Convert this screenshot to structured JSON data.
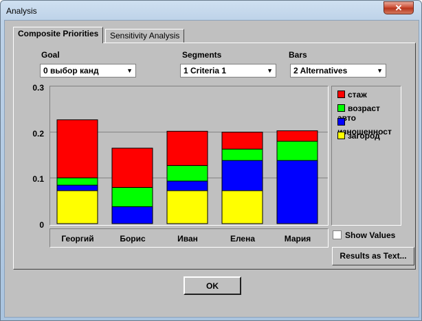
{
  "window": {
    "title": "Analysis",
    "close_label": "✕"
  },
  "tabs": [
    {
      "label": "Composite Priorities",
      "active": true
    },
    {
      "label": "Sensitivity Analysis",
      "active": false
    }
  ],
  "controls": {
    "goal": {
      "label": "Goal",
      "value": "0 выбор канд"
    },
    "segments": {
      "label": "Segments",
      "value": "1 Criteria 1"
    },
    "bars": {
      "label": "Bars",
      "value": "2 Alternatives"
    }
  },
  "chart_data": {
    "type": "bar",
    "stacked": true,
    "categories": [
      "Георгий",
      "Борис",
      "Иван",
      "Елена",
      "Мария"
    ],
    "y_ticks": [
      "0.3",
      "0.2",
      "0.1",
      "0"
    ],
    "ylim": [
      0,
      0.3
    ],
    "grid": true,
    "legend_position": "right",
    "series": [
      {
        "name": "загород",
        "color": "#ffff00",
        "values": [
          0.072,
          0,
          0.072,
          0.072,
          0
        ]
      },
      {
        "name": "изношенност",
        "color": "#0000ff",
        "values": [
          0.012,
          0.037,
          0.021,
          0.066,
          0.138
        ]
      },
      {
        "name": "возраст авто",
        "color": "#00ff00",
        "values": [
          0.016,
          0.042,
          0.034,
          0.025,
          0.042
        ]
      },
      {
        "name": "стаж",
        "color": "#ff0000",
        "values": [
          0.127,
          0.086,
          0.075,
          0.037,
          0.023
        ]
      }
    ]
  },
  "legend": [
    {
      "label": "стаж",
      "color": "#ff0000"
    },
    {
      "label": "возраст авто",
      "color": "#00ff00"
    },
    {
      "label": "изношенност",
      "color": "#0000ff"
    },
    {
      "label": "загород",
      "color": "#ffff00"
    }
  ],
  "show_values": {
    "label": "Show Values",
    "checked": false
  },
  "buttons": {
    "results": "Results as Text...",
    "ok": "OK"
  },
  "icons": {
    "combo_arrow": "dropdown-arrow-icon",
    "close": "close-icon"
  }
}
